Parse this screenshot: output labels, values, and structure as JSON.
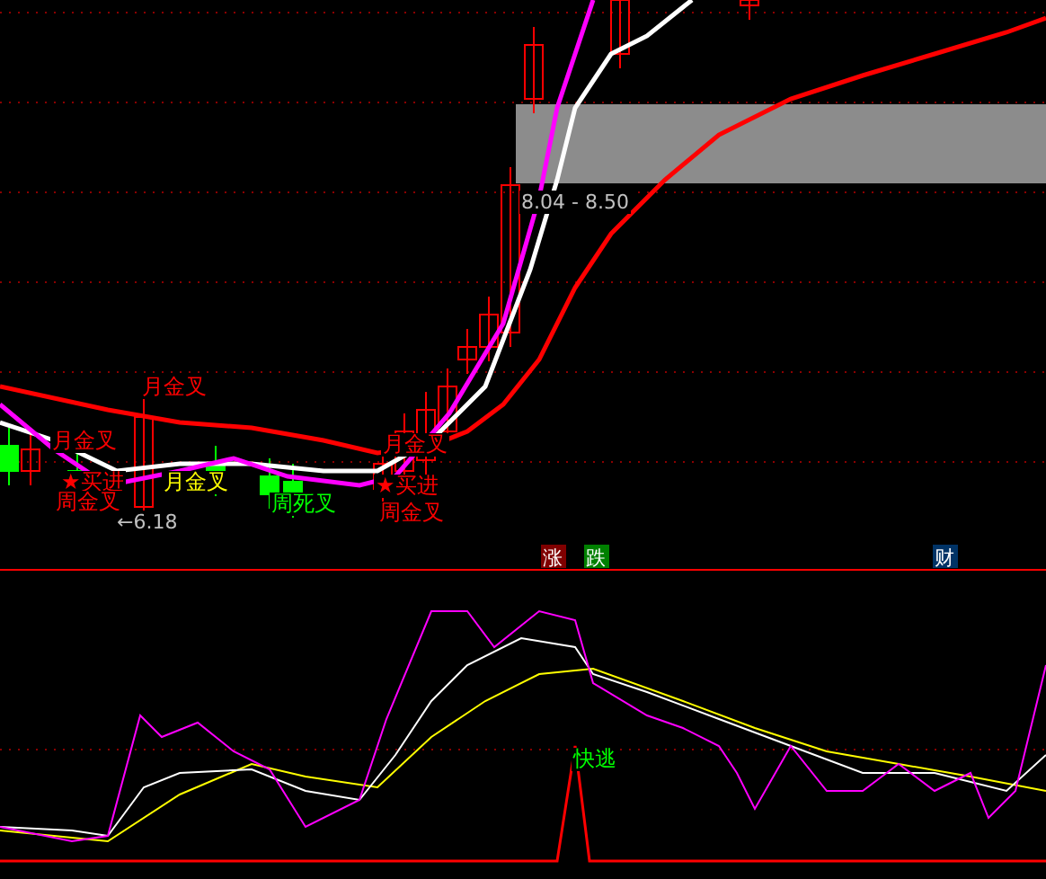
{
  "main_chart": {
    "labels": [
      {
        "text": "月金叉",
        "color": "#ff0000"
      },
      {
        "text": "月金叉",
        "color": "#ff0000"
      },
      {
        "text": "★买进",
        "color": "#ff0000"
      },
      {
        "text": "周金叉",
        "color": "#ff0000"
      },
      {
        "text": "月金叉",
        "color": "#ffff00"
      },
      {
        "text": "周死叉",
        "color": "#00ff00"
      },
      {
        "text": "月金叉",
        "color": "#ff0000"
      },
      {
        "text": "★买进",
        "color": "#ff0000"
      },
      {
        "text": "周金叉",
        "color": "#ff0000"
      }
    ],
    "price_range": "8.04 - 8.50",
    "low_marker": "←6.18"
  },
  "tags": [
    {
      "text": "涨",
      "color": "#800000"
    },
    {
      "text": "跌",
      "color": "#008000"
    },
    {
      "text": "财",
      "color": "#003366"
    }
  ],
  "indicator": {
    "signal": "快逃"
  }
}
